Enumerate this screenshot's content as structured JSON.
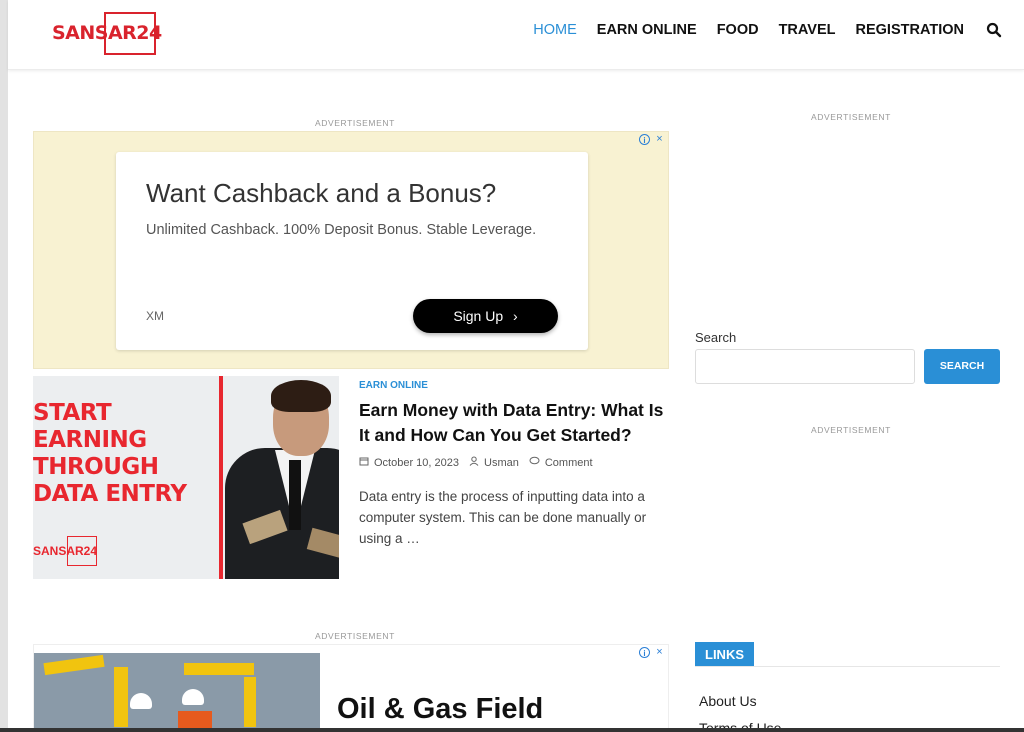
{
  "site": {
    "logo_text": "SANSAR24"
  },
  "nav": {
    "items": [
      {
        "label": "HOME",
        "active": true
      },
      {
        "label": "EARN ONLINE",
        "active": false
      },
      {
        "label": "FOOD",
        "active": false
      },
      {
        "label": "TRAVEL",
        "active": false
      },
      {
        "label": "REGISTRATION",
        "active": false
      }
    ],
    "search_icon": "search-icon"
  },
  "ads": {
    "label": "ADVERTISEMENT",
    "ad1": {
      "heading": "Want Cashback and a Bonus?",
      "subtext": "Unlimited Cashback. 100% Deposit Bonus. Stable Leverage.",
      "brand": "XM",
      "button": "Sign Up",
      "info_icon": "i",
      "close_icon": "×"
    },
    "ad2": {
      "heading": "Oil & Gas Field",
      "info_icon": "i",
      "close_icon": "×"
    }
  },
  "post": {
    "category": "EARN ONLINE",
    "title": "Earn Money with Data Entry: What Is It and How Can You Get Started?",
    "date": "October 10, 2023",
    "author": "Usman",
    "comment": "Comment",
    "excerpt": "Data entry is the process of inputting data into a computer system. This can be done manually or using a …",
    "thumb_text": [
      "START",
      "EARNING",
      "THROUGH",
      "DATA ENTRY"
    ],
    "thumb_logo": "SANSAR24"
  },
  "sidebar": {
    "search_label": "Search",
    "search_placeholder": "",
    "search_button": "SEARCH",
    "links_title": "LINKS",
    "links": [
      "About Us",
      "Terms of Use"
    ]
  },
  "colors": {
    "accent": "#2a8fd6",
    "brand_red": "#d9232d",
    "ad_bg": "#f8f2d2"
  }
}
